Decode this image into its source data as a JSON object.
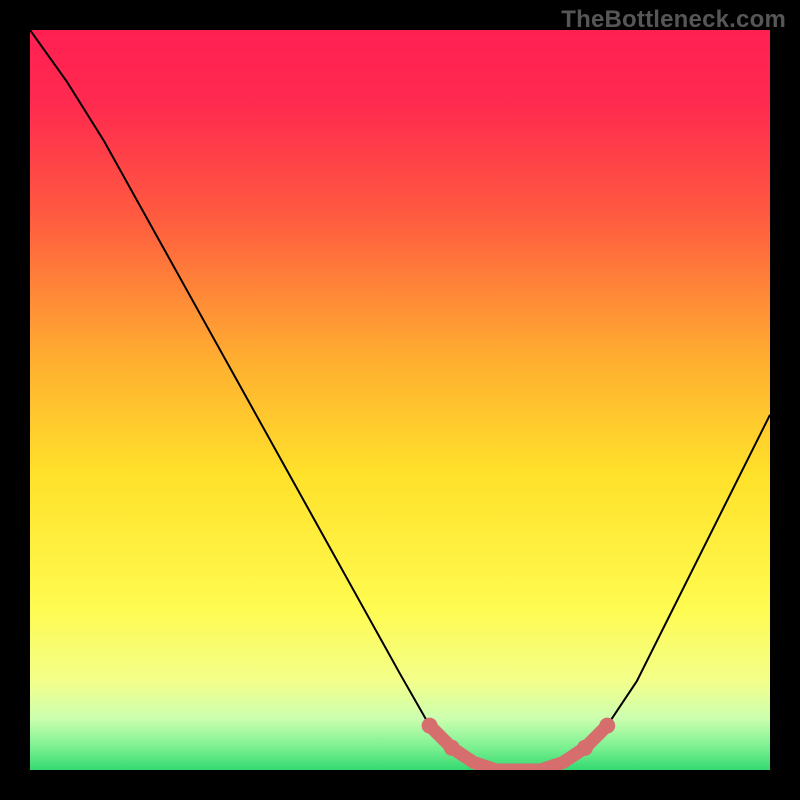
{
  "watermark": "TheBottleneck.com",
  "colors": {
    "background": "#000000",
    "curve": "#000000",
    "marker": "#d66e6e",
    "gradient_top": "#ff2052",
    "gradient_mid_high": "#ff6a3a",
    "gradient_mid": "#ffd92b",
    "gradient_low": "#f6ff7a",
    "gradient_band": "#d6ffa0",
    "gradient_bottom": "#39e27a"
  },
  "chart_data": {
    "type": "line",
    "title": "",
    "xlabel": "",
    "ylabel": "",
    "xlim": [
      0,
      1
    ],
    "ylim": [
      0,
      1
    ],
    "series": [
      {
        "name": "bottleneck-curve",
        "x": [
          0.0,
          0.05,
          0.1,
          0.15,
          0.2,
          0.25,
          0.3,
          0.35,
          0.4,
          0.45,
          0.5,
          0.54,
          0.58,
          0.62,
          0.66,
          0.7,
          0.74,
          0.78,
          0.82,
          0.86,
          0.9,
          0.95,
          1.0
        ],
        "y": [
          1.0,
          0.93,
          0.85,
          0.76,
          0.67,
          0.58,
          0.49,
          0.4,
          0.31,
          0.22,
          0.13,
          0.06,
          0.02,
          0.0,
          0.0,
          0.0,
          0.02,
          0.06,
          0.12,
          0.2,
          0.28,
          0.38,
          0.48
        ]
      }
    ],
    "markers": {
      "name": "optimal-range",
      "x": [
        0.54,
        0.57,
        0.6,
        0.63,
        0.66,
        0.69,
        0.72,
        0.75,
        0.78
      ],
      "y": [
        0.06,
        0.03,
        0.01,
        0.0,
        0.0,
        0.0,
        0.01,
        0.03,
        0.06
      ]
    },
    "gradient_stops": [
      {
        "offset": 0.0,
        "color": "#ff2052"
      },
      {
        "offset": 0.1,
        "color": "#ff2a4f"
      },
      {
        "offset": 0.25,
        "color": "#ff5a40"
      },
      {
        "offset": 0.45,
        "color": "#ffb030"
      },
      {
        "offset": 0.6,
        "color": "#ffe12a"
      },
      {
        "offset": 0.78,
        "color": "#fffb50"
      },
      {
        "offset": 0.88,
        "color": "#f3ff8a"
      },
      {
        "offset": 0.93,
        "color": "#ccffb0"
      },
      {
        "offset": 0.97,
        "color": "#7af090"
      },
      {
        "offset": 1.0,
        "color": "#34da72"
      }
    ]
  }
}
